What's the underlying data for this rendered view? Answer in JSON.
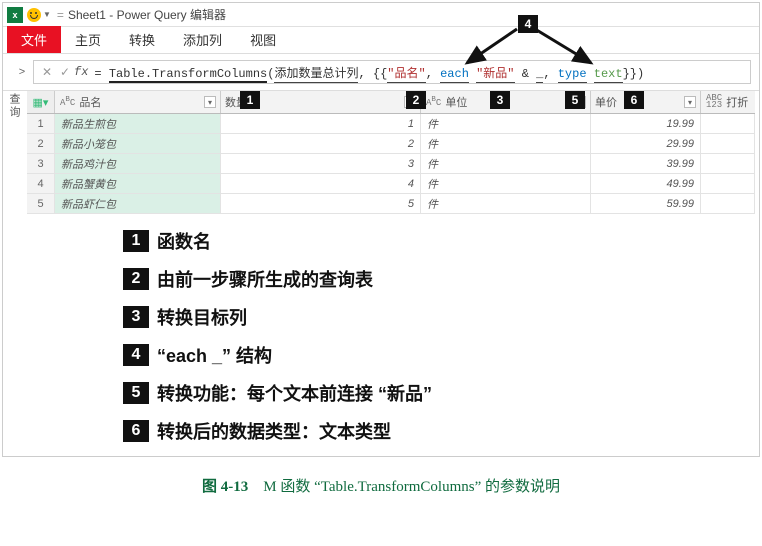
{
  "window": {
    "title": "Sheet1 - Power Query 编辑器",
    "qat_sep": "=",
    "expand": ">"
  },
  "tabs": {
    "file": "文件",
    "home": "主页",
    "transform": "转换",
    "addcol": "添加列",
    "view": "视图"
  },
  "sidebar": {
    "label": "查询"
  },
  "formula": {
    "fx": "fx",
    "eq": "= ",
    "fn": "Table.TransformColumns",
    "open": "(",
    "arg1": "添加数量总计列",
    "comma1": ", {{",
    "colname": "\"品名\"",
    "comma2": ", ",
    "each": "each",
    "sp1": " ",
    "newstr": "\"新品\"",
    "sp2": " ",
    "amp": "&",
    "sp3": " ",
    "underscore": "_",
    "comma3": ", ",
    "type": "type",
    "sp4": " ",
    "text": "text",
    "close": "}})"
  },
  "columns": {
    "name": "品名",
    "qty": "数量",
    "unit": "单位",
    "price": "单价",
    "disc": "打折",
    "abc": "ABC",
    "num123": "123",
    "abc123": "ABC\n123"
  },
  "rows": [
    {
      "n": "1",
      "name": "新品生煎包",
      "qty": "1",
      "unit": "件",
      "price": "19.99"
    },
    {
      "n": "2",
      "name": "新品小笼包",
      "qty": "2",
      "unit": "件",
      "price": "29.99"
    },
    {
      "n": "3",
      "name": "新品鸡汁包",
      "qty": "3",
      "unit": "件",
      "price": "39.99"
    },
    {
      "n": "4",
      "name": "新品蟹黄包",
      "qty": "4",
      "unit": "件",
      "price": "49.99"
    },
    {
      "n": "5",
      "name": "新品虾仁包",
      "qty": "5",
      "unit": "件",
      "price": "59.99"
    }
  ],
  "labels": {
    "l1": "1",
    "l2": "2",
    "l3": "3",
    "l4": "4",
    "l5": "5",
    "l6": "6"
  },
  "legend": [
    {
      "n": "1",
      "t": "函数名"
    },
    {
      "n": "2",
      "t": "由前一步骤所生成的查询表"
    },
    {
      "n": "3",
      "t": "转换目标列"
    },
    {
      "n": "4",
      "t": "“each _” 结构"
    },
    {
      "n": "5",
      "t": "转换功能：每个文本前连接 “新品”"
    },
    {
      "n": "6",
      "t": "转换后的数据类型：文本类型"
    }
  ],
  "caption": {
    "figno": "图 4-13",
    "text": "　M 函数 “Table.TransformColumns” 的参数说明"
  }
}
